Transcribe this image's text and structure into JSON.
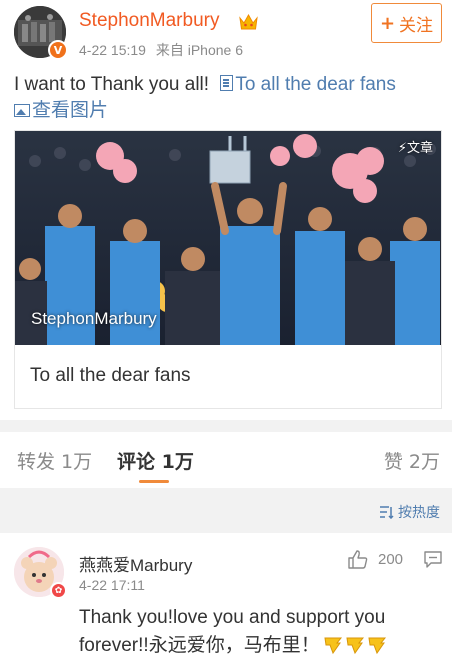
{
  "post": {
    "username": "StephonMarbury",
    "meta": {
      "date": "4-22 15:19",
      "source": "来自 iPhone 6"
    },
    "follow_label": "关注",
    "text": "I want to Thank you all!",
    "link_text": "To all the dear fans",
    "view_image_label": "查看图片"
  },
  "card": {
    "watermark": "StephonMarbury",
    "article_tag": "文章",
    "title": "To all the dear fans"
  },
  "tabs": [
    {
      "label": "转发 1万",
      "active": false
    },
    {
      "label": "评论 1万",
      "active": true
    },
    {
      "label": "赞 2万",
      "active": false
    }
  ],
  "sort": {
    "label": "按热度"
  },
  "comment": {
    "name": "燕燕爱Marbury",
    "time": "4-22 17:11",
    "likes": "200",
    "text": "Thank you!love you and support you forever!!永远爱你，马布里！"
  },
  "colors": {
    "accent": "#f15a22",
    "link": "#507daf",
    "muted": "#8a8a8a"
  }
}
